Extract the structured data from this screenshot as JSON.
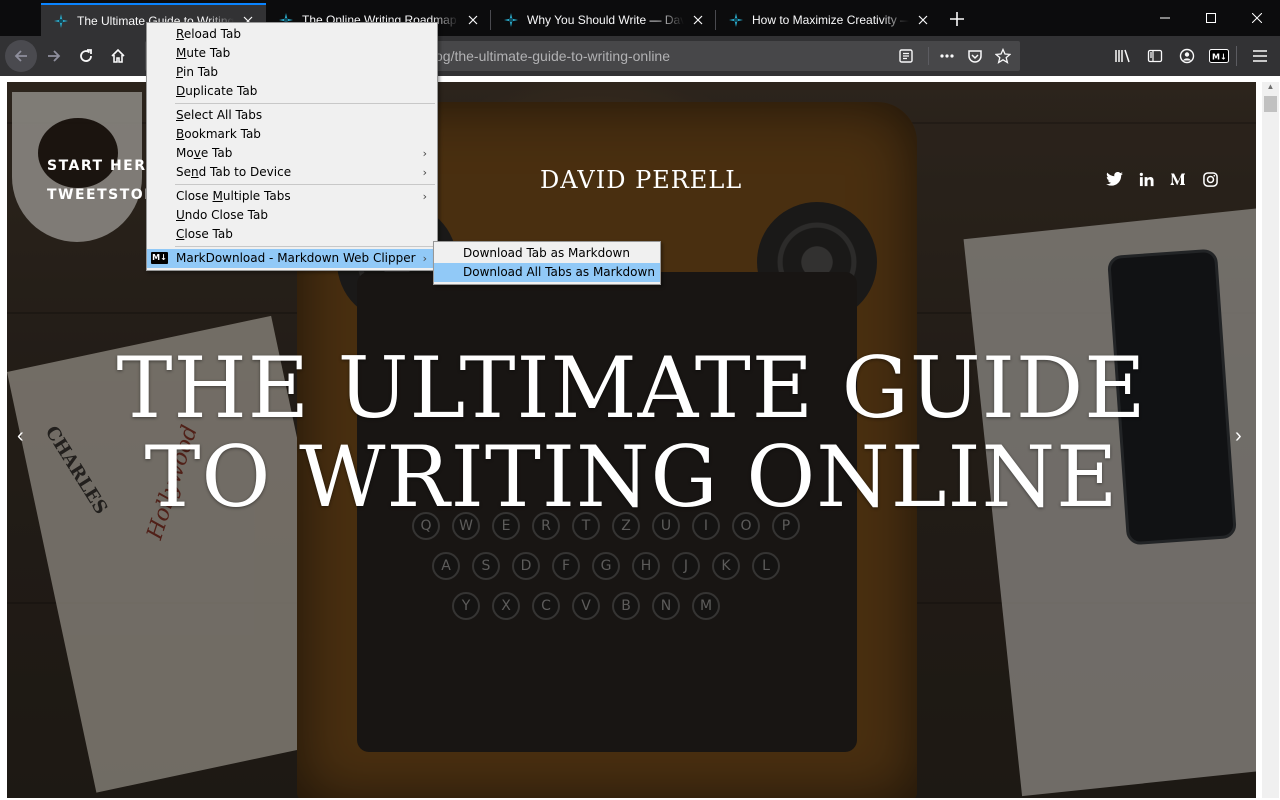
{
  "tabs": [
    {
      "title": "The Ultimate Guide to Writing Online",
      "selected": true
    },
    {
      "title": "The Online Writing Roadmap — David Perell",
      "selected": false
    },
    {
      "title": "Why You Should Write — David Perell",
      "selected": false
    },
    {
      "title": "How to Maximize Creativity — David Perell",
      "selected": false
    }
  ],
  "navbar": {
    "url": "og/the-ultimate-guide-to-writing-online"
  },
  "context_menu": {
    "items": [
      {
        "pre": "",
        "acc": "R",
        "post": "eload Tab"
      },
      {
        "pre": "",
        "acc": "M",
        "post": "ute Tab"
      },
      {
        "pre": "",
        "acc": "P",
        "post": "in Tab"
      },
      {
        "pre": "",
        "acc": "D",
        "post": "uplicate Tab"
      },
      {
        "pre": "",
        "acc": "S",
        "post": "elect All Tabs"
      },
      {
        "pre": "",
        "acc": "B",
        "post": "ookmark Tab"
      },
      {
        "pre": "Mo",
        "acc": "v",
        "post": "e Tab"
      },
      {
        "pre": "Se",
        "acc": "n",
        "post": "d Tab to Device"
      },
      {
        "pre": "Close ",
        "acc": "M",
        "post": "ultiple Tabs"
      },
      {
        "pre": "",
        "acc": "U",
        "post": "ndo Close Tab"
      },
      {
        "pre": "",
        "acc": "C",
        "post": "lose Tab"
      },
      {
        "label": "MarkDownload - Markdown Web Clipper"
      }
    ],
    "md_icon_text": "M↓"
  },
  "submenu": {
    "items": [
      {
        "label": "Download Tab as Markdown"
      },
      {
        "label": "Download All Tabs as Markdown"
      }
    ]
  },
  "page": {
    "nav_links": [
      "START HERE",
      "TWEETSTORMS"
    ],
    "site_name": "DAVID PERELL",
    "headline_line1": "THE ULTIMATE GUIDE",
    "headline_line2": "TO WRITING ONLINE",
    "prev_arrow": "‹",
    "next_arrow": "›",
    "social_icons": [
      "twitter-icon",
      "linkedin-icon",
      "medium-icon",
      "instagram-icon"
    ]
  },
  "colors": {
    "accent": "#0a84ff",
    "menu_highlight": "#91c9f7",
    "toolbar": "#323234",
    "tabstrip": "#0c0c0d"
  }
}
